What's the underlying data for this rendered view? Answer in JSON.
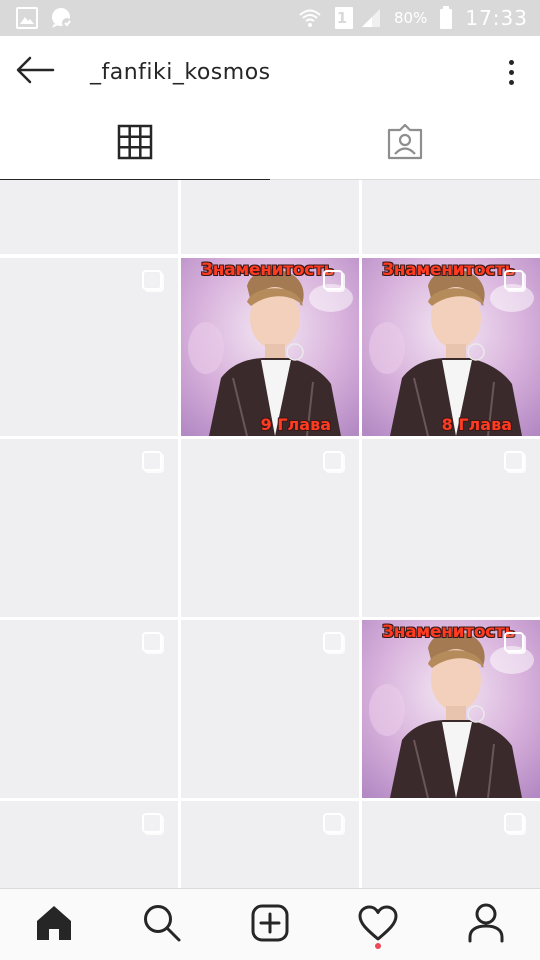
{
  "status_bar": {
    "icons_left": [
      "gallery-icon",
      "chat-bubble-icon"
    ],
    "icons_right": [
      "wifi-icon",
      "sim-icon",
      "signal-icon",
      "battery-icon"
    ],
    "sim_label": "1",
    "battery_text": "80%",
    "time": "17:33"
  },
  "header": {
    "profile_name": "_fanfiki_kosmos"
  },
  "tabs": [
    {
      "name": "grid-tab",
      "icon": "grid-icon",
      "active": true
    },
    {
      "name": "tagged-tab",
      "icon": "tagged-user-icon",
      "active": false
    }
  ],
  "grid": {
    "posts": [
      {
        "row": 0,
        "col": 0,
        "image": false,
        "selectable": false
      },
      {
        "row": 0,
        "col": 1,
        "image": false,
        "selectable": false
      },
      {
        "row": 0,
        "col": 2,
        "image": false,
        "selectable": false
      },
      {
        "row": 1,
        "col": 0,
        "image": false,
        "selectable": true
      },
      {
        "row": 1,
        "col": 1,
        "image": true,
        "selectable": true,
        "title": "Знаменитость",
        "chapter": "9 Глава"
      },
      {
        "row": 1,
        "col": 2,
        "image": true,
        "selectable": true,
        "title": "Знаменитость",
        "chapter": "8 Глава"
      },
      {
        "row": 2,
        "col": 0,
        "image": false,
        "selectable": true
      },
      {
        "row": 2,
        "col": 1,
        "image": false,
        "selectable": true
      },
      {
        "row": 2,
        "col": 2,
        "image": false,
        "selectable": true
      },
      {
        "row": 3,
        "col": 0,
        "image": false,
        "selectable": true
      },
      {
        "row": 3,
        "col": 1,
        "image": false,
        "selectable": true
      },
      {
        "row": 3,
        "col": 2,
        "image": true,
        "selectable": true,
        "title": "Знаменитость",
        "chapter": ""
      },
      {
        "row": 4,
        "col": 0,
        "image": false,
        "selectable": true
      },
      {
        "row": 4,
        "col": 1,
        "image": false,
        "selectable": true
      },
      {
        "row": 4,
        "col": 2,
        "image": false,
        "selectable": true
      }
    ]
  },
  "bottom_nav": [
    {
      "name": "home",
      "icon": "home-icon",
      "active": true
    },
    {
      "name": "search",
      "icon": "search-icon",
      "active": false
    },
    {
      "name": "new-post",
      "icon": "add-post-icon",
      "active": false
    },
    {
      "name": "activity",
      "icon": "heart-icon",
      "active": false,
      "notification": true
    },
    {
      "name": "profile",
      "icon": "profile-icon",
      "active": false
    }
  ],
  "colors": {
    "status_bar": "#d9d9d9",
    "cell_placeholder": "#efeff1",
    "thumbnail_text": "#ff3b21",
    "notification_dot": "#ed4956",
    "icon": "#262626"
  }
}
